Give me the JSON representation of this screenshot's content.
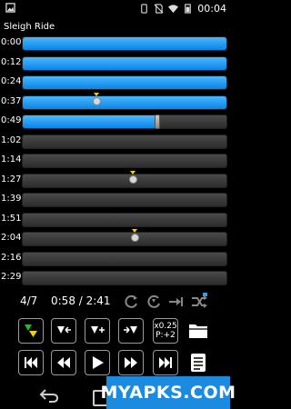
{
  "status": {
    "time": "00:04"
  },
  "song_title": "Sleigh Ride",
  "rows": [
    {
      "time": "0:00",
      "fill": 1.0
    },
    {
      "time": "0:12",
      "fill": 1.0
    },
    {
      "time": "0:24",
      "fill": 1.0
    },
    {
      "time": "0:37",
      "fill": 1.0,
      "marker": 0.36
    },
    {
      "time": "0:49",
      "fill": 0.66,
      "handle": 0.66
    },
    {
      "time": "1:02",
      "fill": 0
    },
    {
      "time": "1:14",
      "fill": 0
    },
    {
      "time": "1:27",
      "fill": 0,
      "marker": 0.54
    },
    {
      "time": "1:39",
      "fill": 0
    },
    {
      "time": "1:51",
      "fill": 0
    },
    {
      "time": "2:04",
      "fill": 0,
      "marker": 0.55
    },
    {
      "time": "2:16",
      "fill": 0
    },
    {
      "time": "2:29",
      "fill": 0
    }
  ],
  "playback": {
    "track_count": "4/7",
    "position": "0:58 / 2:41"
  },
  "speed_pitch": {
    "speed": "x0.25",
    "pitch": "P:+2"
  },
  "icons": {
    "repeat": "repeat-icon",
    "ab_repeat": "ab-loop-icon",
    "next_track": "skip-to-end-icon",
    "shuffle": "shuffle-icon",
    "folder": "folder-icon",
    "playlist": "playlist-icon"
  },
  "watermark": "MYAPKS.COM",
  "colors": {
    "accent": "#1b8be0",
    "fill": "#2f9ef7",
    "marker": "#f0d000"
  }
}
